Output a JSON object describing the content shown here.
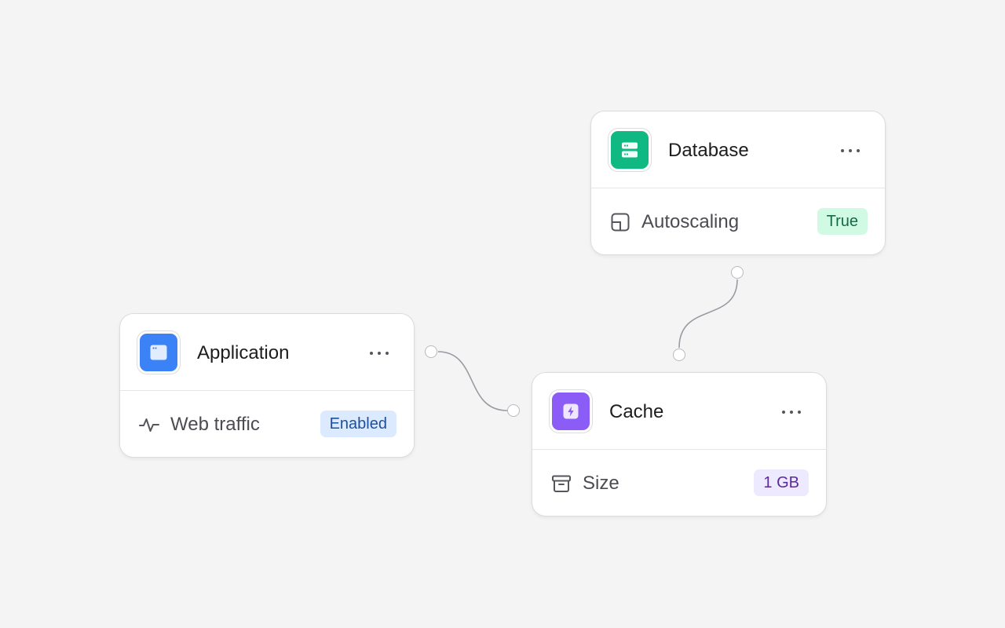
{
  "colors": {
    "background": "#f4f4f4",
    "card": "#ffffff",
    "edge": "#9a9aa3",
    "application_icon": "#3b82f6",
    "database_icon": "#10b981",
    "cache_icon": "#8b5cf6"
  },
  "nodes": {
    "application": {
      "title": "Application",
      "icon": "browser-window-icon",
      "menu_icon": "more-horizontal-icon",
      "property": {
        "icon": "activity-pulse-icon",
        "label": "Web traffic",
        "value": "Enabled",
        "badge_bg": "#dbeafe",
        "badge_fg": "#1e4f9a"
      }
    },
    "database": {
      "title": "Database",
      "icon": "server-icon",
      "menu_icon": "more-horizontal-icon",
      "property": {
        "icon": "scale-icon",
        "label": "Autoscaling",
        "value": "True",
        "badge_bg": "#d1fae5",
        "badge_fg": "#166a44"
      }
    },
    "cache": {
      "title": "Cache",
      "icon": "lightning-bolt-icon",
      "menu_icon": "more-horizontal-icon",
      "property": {
        "icon": "archive-box-icon",
        "label": "Size",
        "value": "1 GB",
        "badge_bg": "#ede9fe",
        "badge_fg": "#5b2a97"
      }
    }
  },
  "edges": [
    {
      "from": "application",
      "to": "cache"
    },
    {
      "from": "database",
      "to": "cache"
    }
  ]
}
